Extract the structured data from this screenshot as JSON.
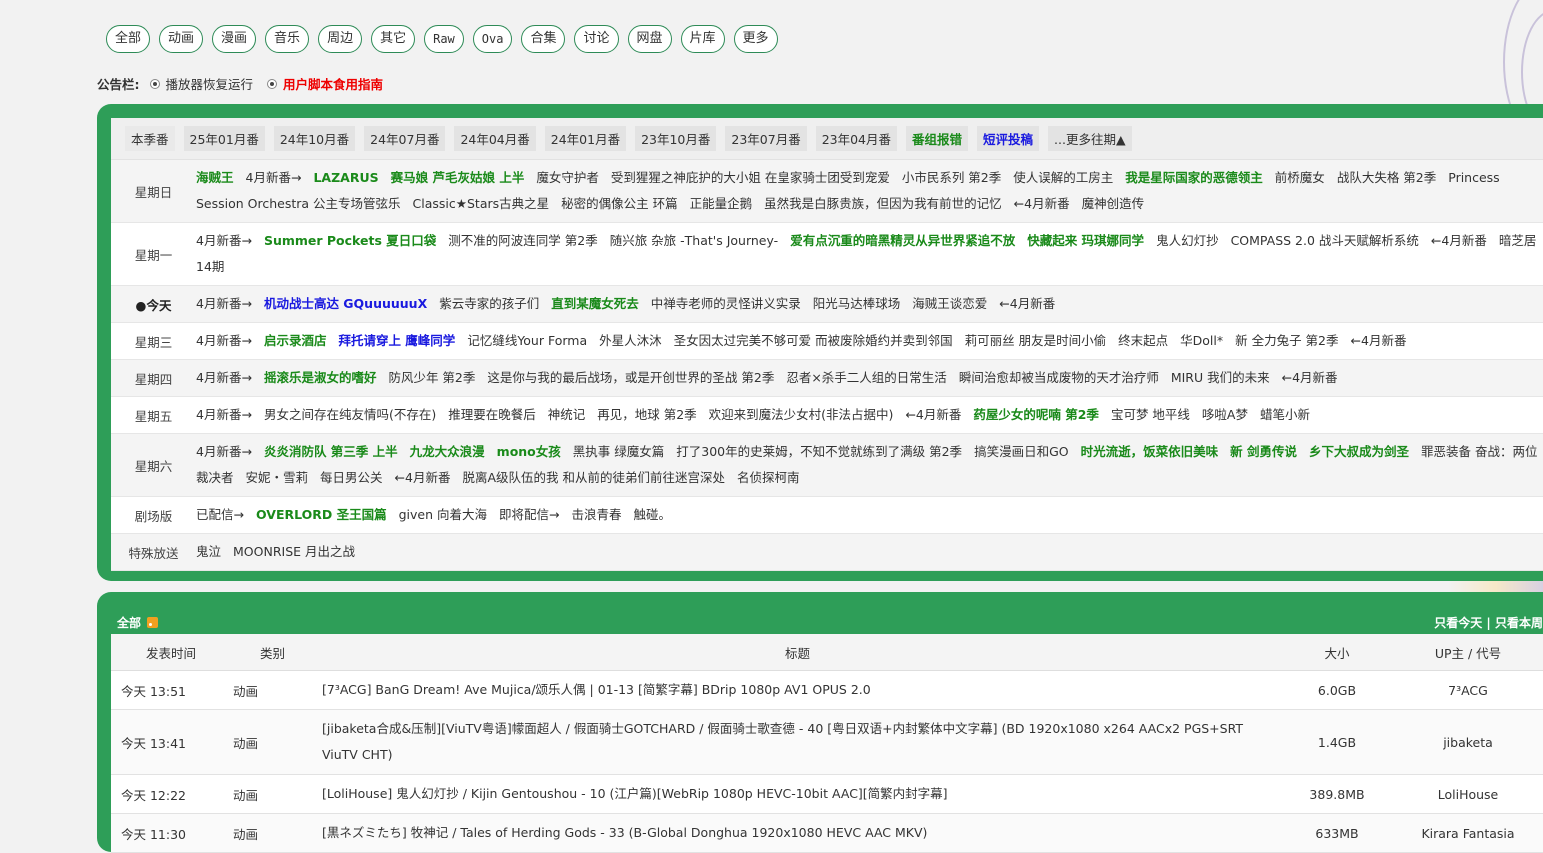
{
  "categories": [
    "全部",
    "动画",
    "漫画",
    "音乐",
    "周边",
    "其它",
    "Raw",
    "Ova",
    "合集",
    "讨论",
    "网盘",
    "片库",
    "更多"
  ],
  "announce": {
    "label": "公告栏:",
    "items": [
      {
        "text": "播放器恢复运行",
        "style": "normal"
      },
      {
        "text": "用户脚本食用指南",
        "style": "red"
      }
    ]
  },
  "seasons": [
    {
      "text": "本季番",
      "style": "cur"
    },
    {
      "text": "25年01月番",
      "style": "normal"
    },
    {
      "text": "24年10月番",
      "style": "normal"
    },
    {
      "text": "24年07月番",
      "style": "normal"
    },
    {
      "text": "24年04月番",
      "style": "normal"
    },
    {
      "text": "24年01月番",
      "style": "normal"
    },
    {
      "text": "23年10月番",
      "style": "normal"
    },
    {
      "text": "23年07月番",
      "style": "normal"
    },
    {
      "text": "23年04月番",
      "style": "normal"
    },
    {
      "text": "番组报错",
      "style": "hi"
    },
    {
      "text": "短评投稿",
      "style": "blue"
    },
    {
      "text": "...更多往期▲",
      "style": "normal"
    }
  ],
  "schedule": [
    {
      "day": "星期日",
      "alt": true,
      "shows": [
        {
          "t": "海贼王",
          "s": "g"
        },
        {
          "t": "4月新番→",
          "s": ""
        },
        {
          "t": "LAZARUS",
          "s": "g"
        },
        {
          "t": "赛马娘 芦毛灰姑娘 上半",
          "s": "g"
        },
        {
          "t": "魔女守护者",
          "s": ""
        },
        {
          "t": "受到猩猩之神庇护的大小姐 在皇家骑士团受到宠爱",
          "s": ""
        },
        {
          "t": "小市民系列 第2季",
          "s": ""
        },
        {
          "t": "使人误解的工房主",
          "s": ""
        },
        {
          "t": "我是星际国家的恶德领主",
          "s": "g"
        },
        {
          "t": "前桥魔女",
          "s": ""
        },
        {
          "t": "战队大失格 第2季",
          "s": ""
        },
        {
          "t": "Princess Session Orchestra 公主专场管弦乐",
          "s": "wrap"
        },
        {
          "t": "Classic★Stars古典之星",
          "s": ""
        },
        {
          "t": "秘密的偶像公主 环篇",
          "s": ""
        },
        {
          "t": "正能量企鹅",
          "s": ""
        },
        {
          "t": "虽然我是白豚贵族，但因为我有前世的记忆",
          "s": ""
        },
        {
          "t": "←4月新番",
          "s": ""
        },
        {
          "t": "魔神创造传",
          "s": ""
        }
      ]
    },
    {
      "day": "星期一",
      "alt": false,
      "shows": [
        {
          "t": "4月新番→",
          "s": ""
        },
        {
          "t": "Summer Pockets 夏日口袋",
          "s": "g"
        },
        {
          "t": "测不准的阿波连同学 第2季",
          "s": ""
        },
        {
          "t": "随兴旅 杂旅 -That's Journey-",
          "s": ""
        },
        {
          "t": "爱有点沉重的暗黑精灵从异世界紧追不放",
          "s": "g"
        },
        {
          "t": "快藏起来 玛琪娜同学",
          "s": "g"
        },
        {
          "t": "鬼人幻灯抄",
          "s": ""
        },
        {
          "t": "COMPASS 2.0 战斗天赋解析系统",
          "s": ""
        },
        {
          "t": "←4月新番",
          "s": ""
        },
        {
          "t": "暗芝居 14期",
          "s": "wrap"
        }
      ]
    },
    {
      "day": "●今天",
      "alt": true,
      "today": true,
      "shows": [
        {
          "t": "4月新番→",
          "s": ""
        },
        {
          "t": "机动战士高达 GQuuuuuuX",
          "s": "b"
        },
        {
          "t": "紫云寺家的孩子们",
          "s": ""
        },
        {
          "t": "直到某魔女死去",
          "s": "g"
        },
        {
          "t": "中禅寺老师的灵怪讲义实录",
          "s": ""
        },
        {
          "t": "阳光马达棒球场",
          "s": ""
        },
        {
          "t": "海贼王谈恋爱",
          "s": ""
        },
        {
          "t": "←4月新番",
          "s": ""
        }
      ]
    },
    {
      "day": "星期三",
      "alt": false,
      "shows": [
        {
          "t": "4月新番→",
          "s": ""
        },
        {
          "t": "启示录酒店",
          "s": "g"
        },
        {
          "t": "拜托请穿上 鹰峰同学",
          "s": "b"
        },
        {
          "t": "记忆缝线Your Forma",
          "s": ""
        },
        {
          "t": "外星人沐沐",
          "s": ""
        },
        {
          "t": "圣女因太过完美不够可爱 而被废除婚约并卖到邻国",
          "s": ""
        },
        {
          "t": "莉可丽丝 朋友是时间小偷",
          "s": ""
        },
        {
          "t": "终末起点",
          "s": ""
        },
        {
          "t": "华Doll*",
          "s": ""
        },
        {
          "t": "新 全力兔子 第2季",
          "s": ""
        },
        {
          "t": "←4月新番",
          "s": ""
        }
      ]
    },
    {
      "day": "星期四",
      "alt": true,
      "shows": [
        {
          "t": "4月新番→",
          "s": ""
        },
        {
          "t": "摇滚乐是淑女的嗜好",
          "s": "g"
        },
        {
          "t": "防风少年 第2季",
          "s": ""
        },
        {
          "t": "这是你与我的最后战场，或是开创世界的圣战 第2季",
          "s": ""
        },
        {
          "t": "忍者×杀手二人组的日常生活",
          "s": ""
        },
        {
          "t": "瞬间治愈却被当成废物的天才治疗师",
          "s": ""
        },
        {
          "t": "MIRU 我们的未来",
          "s": ""
        },
        {
          "t": "←4月新番",
          "s": ""
        }
      ]
    },
    {
      "day": "星期五",
      "alt": false,
      "shows": [
        {
          "t": "4月新番→",
          "s": ""
        },
        {
          "t": "男女之间存在纯友情吗(不存在)",
          "s": ""
        },
        {
          "t": "推理要在晚餐后",
          "s": ""
        },
        {
          "t": "神统记",
          "s": ""
        },
        {
          "t": "再见，地球 第2季",
          "s": ""
        },
        {
          "t": "欢迎来到魔法少女村(非法占据中)",
          "s": ""
        },
        {
          "t": "←4月新番",
          "s": ""
        },
        {
          "t": "药屋少女的呢喃 第2季",
          "s": "g"
        },
        {
          "t": "宝可梦 地平线",
          "s": ""
        },
        {
          "t": "哆啦A梦",
          "s": ""
        },
        {
          "t": "蜡笔小新",
          "s": ""
        }
      ]
    },
    {
      "day": "星期六",
      "alt": true,
      "shows": [
        {
          "t": "4月新番→",
          "s": ""
        },
        {
          "t": "炎炎消防队 第三季 上半",
          "s": "g"
        },
        {
          "t": "九龙大众浪漫",
          "s": "g"
        },
        {
          "t": "mono女孩",
          "s": "g"
        },
        {
          "t": "黑执事 绿魔女篇",
          "s": ""
        },
        {
          "t": "打了300年的史莱姆，不知不觉就练到了满级 第2季",
          "s": ""
        },
        {
          "t": "搞笑漫画日和GO",
          "s": ""
        },
        {
          "t": "时光流逝，饭菜依旧美味",
          "s": "g"
        },
        {
          "t": "新 剑勇传说",
          "s": "g"
        },
        {
          "t": "乡下大叔成为剑圣",
          "s": "g"
        },
        {
          "t": "罪恶装备 奋战：两位裁决者",
          "s": "wrap"
        },
        {
          "t": "安妮・雪莉",
          "s": ""
        },
        {
          "t": "每日男公关",
          "s": ""
        },
        {
          "t": "←4月新番",
          "s": ""
        },
        {
          "t": "脱离A级队伍的我 和从前的徒弟们前往迷宫深处",
          "s": ""
        },
        {
          "t": "名侦探柯南",
          "s": ""
        }
      ]
    },
    {
      "day": "剧场版",
      "alt": false,
      "shows": [
        {
          "t": "已配信→",
          "s": ""
        },
        {
          "t": "OVERLORD 圣王国篇",
          "s": "g"
        },
        {
          "t": "given 向着大海",
          "s": ""
        },
        {
          "t": "即将配信→",
          "s": ""
        },
        {
          "t": "击浪青春",
          "s": ""
        },
        {
          "t": "触碰。",
          "s": ""
        }
      ]
    },
    {
      "day": "特殊放送",
      "alt": true,
      "shows": [
        {
          "t": "鬼泣",
          "s": ""
        },
        {
          "t": "MOONRISE 月出之战",
          "s": ""
        }
      ]
    }
  ],
  "torrents": {
    "header_label": "全部",
    "links": "只看今天 | 只看本周",
    "columns": [
      "发表时间",
      "类别",
      "标题",
      "大小",
      "UP主 / 代号"
    ],
    "rows": [
      {
        "time": "今天 13:51",
        "type": "动画",
        "title": "[7³ACG] BanG Dream! Ave Mujica/颂乐人偶 | 01-13 [简繁字幕] BDrip 1080p AV1 OPUS 2.0",
        "size": "6.0GB",
        "up": "7³ACG"
      },
      {
        "time": "今天 13:41",
        "type": "动画",
        "title": "[jibaketa合成&压制][ViuTV粤语]幪面超人 / 假面骑士GOTCHARD / 假面骑士歌查德 - 40 [粤日双语+内封繁体中文字幕] (BD 1920x1080 x264 AACx2 PGS+SRT ViuTV CHT)",
        "size": "1.4GB",
        "up": "jibaketa"
      },
      {
        "time": "今天 12:22",
        "type": "动画",
        "title": "[LoliHouse] 鬼人幻灯抄 / Kijin Gentoushou - 10 (江户篇)[WebRip 1080p HEVC-10bit AAC][简繁内封字幕]",
        "size": "389.8MB",
        "up": "LoliHouse"
      },
      {
        "time": "今天 11:30",
        "type": "动画",
        "title": "[黒ネズミたち] 牧神记 / Tales of Herding Gods - 33 (B-Global Donghua 1920x1080 HEVC AAC MKV)",
        "size": "633MB",
        "up": "Kirara Fantasia"
      }
    ]
  },
  "colors": {
    "accent": "#2e9e58",
    "green_text": "#1a8a1a",
    "blue_text": "#1a1adf",
    "red_text": "#ee0000"
  }
}
